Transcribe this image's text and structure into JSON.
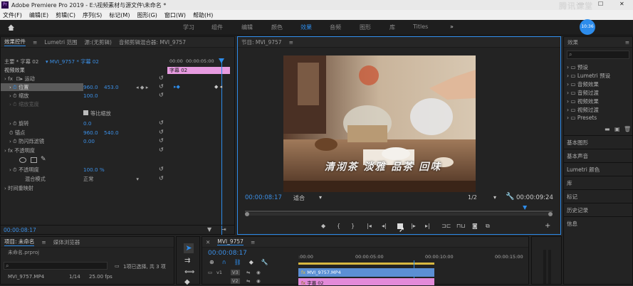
{
  "app": {
    "window_title": "Adobe Premiere Pro 2019 - E:\\视频素材与源文件\\未命名 *",
    "window_controls": {
      "minimize": "—",
      "maximize": "☐",
      "close": "✕"
    },
    "watermark": "腾讯课堂"
  },
  "menu": [
    "文件(F)",
    "编辑(E)",
    "剪辑(C)",
    "序列(S)",
    "标记(M)",
    "图形(G)",
    "窗口(W)",
    "帮助(H)"
  ],
  "workspaces": {
    "tabs": [
      "学习",
      "组件",
      "编辑",
      "颜色",
      "效果",
      "音频",
      "图形",
      "库",
      "Titles"
    ],
    "active": "效果",
    "more": "»",
    "avatar_time": "10:36"
  },
  "effect_controls": {
    "tabs": [
      "效果控件",
      "Lumetri 范围",
      "源:(无剪辑)",
      "音频剪辑混合器: MVI_9757"
    ],
    "menu_icon": "≡",
    "source": "主要 * 字幕 02",
    "target": "MVI_9757 * 字幕 02",
    "mini_time": [
      "00:00",
      "00:00:05:00"
    ],
    "track_label": "字幕 02",
    "section_video": "视频效果",
    "fx_motion": "运动",
    "position": {
      "label": "位置",
      "x": "960.0",
      "y": "453.0"
    },
    "scale": {
      "label": "缩放",
      "value": "100.0"
    },
    "scale_width": {
      "label": "缩放宽度"
    },
    "uniform_scale": {
      "label": "等比缩放"
    },
    "rotation": {
      "label": "旋转",
      "value": "0.0"
    },
    "anchor": {
      "label": "锚点",
      "x": "960.0",
      "y": "540.0"
    },
    "anti_flicker": {
      "label": "防闪烁滤镜",
      "value": "0.00"
    },
    "fx_opacity": "不透明度",
    "opacity": {
      "label": "不透明度",
      "value": "100.0 %"
    },
    "blend": {
      "label": "混合模式",
      "value": "正常"
    },
    "time_remap": "时间重映射",
    "timecode": "00:00:08:17"
  },
  "program": {
    "title": "节目: MVI_9757",
    "menu_icon": "≡",
    "subtitle_text": "清沏茶 淡雅 品茶 回味",
    "timecode": "00:00:08:17",
    "fit": "适合",
    "resolution": "1/2",
    "duration": "00:00:09:24",
    "playhead_fraction": 0.91,
    "controls": [
      "marker",
      "in",
      "out",
      "go-in",
      "step-back",
      "stop",
      "step-forward",
      "go-out",
      "insert",
      "overwrite",
      "export-frame",
      "compare"
    ]
  },
  "effects_panel": {
    "title": "效果",
    "menu_icon": "≡",
    "tree": [
      "预设",
      "Lumetri 预设",
      "音频效果",
      "音频过渡",
      "视频效果",
      "视频过渡",
      "Presets"
    ],
    "sections": [
      "基本图形",
      "基本声音",
      "Lumetri 颜色",
      "库",
      "标记",
      "历史记录",
      "信息"
    ]
  },
  "project": {
    "tabs": [
      "项目: 未命名",
      "媒体浏览器"
    ],
    "file": "未命名.prproj",
    "status": "1项已选择, 共 3 项",
    "item": {
      "name": "MVI_9757.MP4",
      "frame": "1/14",
      "fps": "25.00 fps"
    }
  },
  "timeline": {
    "title": "MVI_9757",
    "timecode": "00:00:08:17",
    "ruler": [
      ":00:00",
      "00:00:05:00",
      "00:00:10:00",
      "00:00:15:00"
    ],
    "playhead_fraction": 0.52,
    "tracks": [
      "V3",
      "V2"
    ],
    "clips": [
      {
        "name": "MVI_9757.MP4",
        "track": "V2",
        "color": "#5b8fd4"
      },
      {
        "name": "字幕 02",
        "track": "V3",
        "color": "#e38ad9"
      }
    ]
  },
  "colors": {
    "accent": "#2d8ceb",
    "title_clip": "#e38ad9",
    "video_clip": "#5b8fd4",
    "tc_blue": "#3b8fe6"
  }
}
